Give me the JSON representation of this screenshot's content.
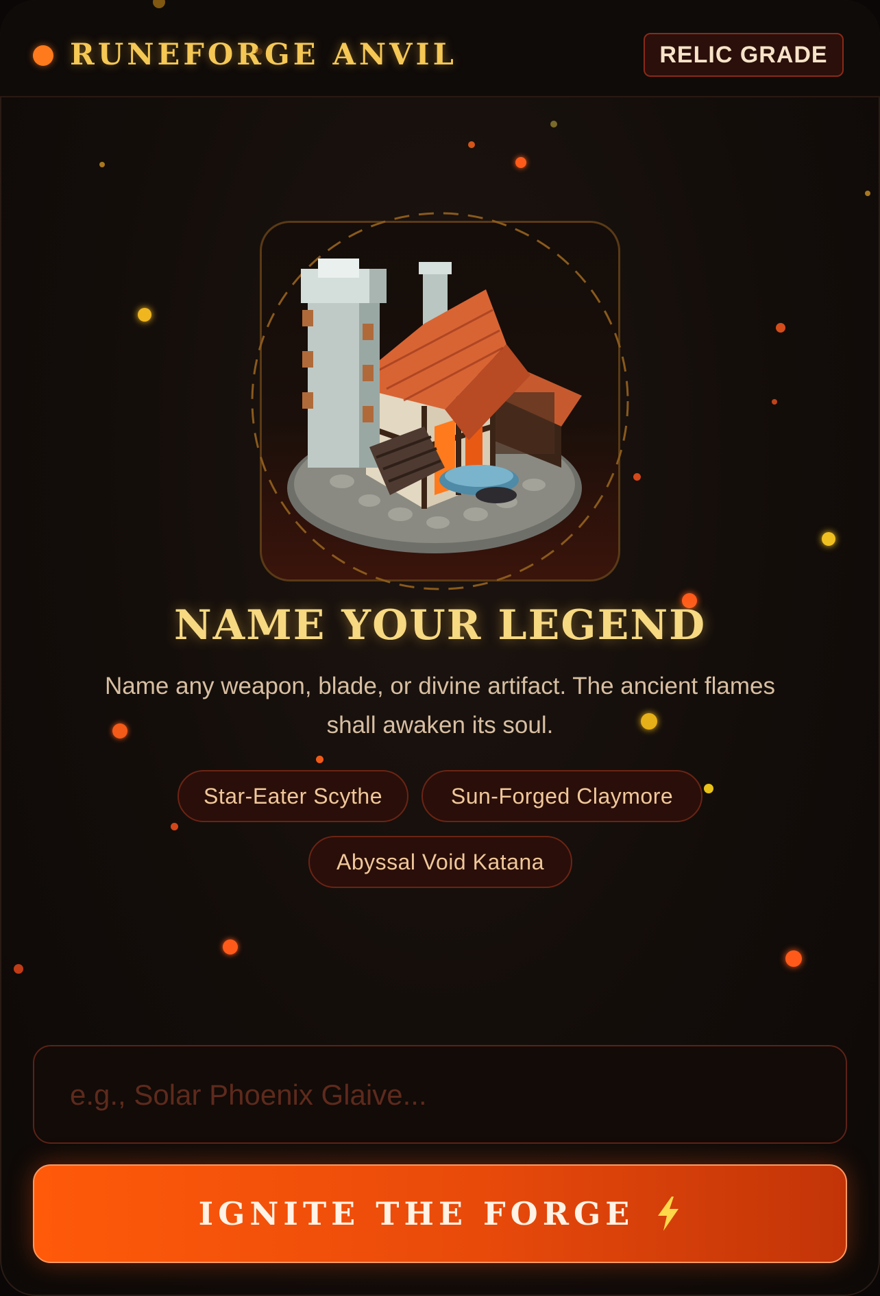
{
  "header": {
    "brand": "RUNEFORGE ANVIL",
    "badge": "RELIC GRADE"
  },
  "hero": {
    "title": "NAME YOUR LEGEND",
    "subtitle": "Name any weapon, blade, or divine artifact. The ancient flames shall awaken its soul."
  },
  "suggestions": [
    {
      "label": "Star-Eater Scythe"
    },
    {
      "label": "Sun-Forged Claymore"
    },
    {
      "label": "Abyssal Void Katana"
    }
  ],
  "input": {
    "value": "",
    "placeholder": "e.g., Solar Phoenix Glaive..."
  },
  "cta": {
    "label": "IGNITE THE FORGE",
    "icon": "lightning-bolt-icon"
  },
  "colors": {
    "accent": "#ff5a0a",
    "gold": "#f5c855",
    "background": "#130d0a"
  }
}
